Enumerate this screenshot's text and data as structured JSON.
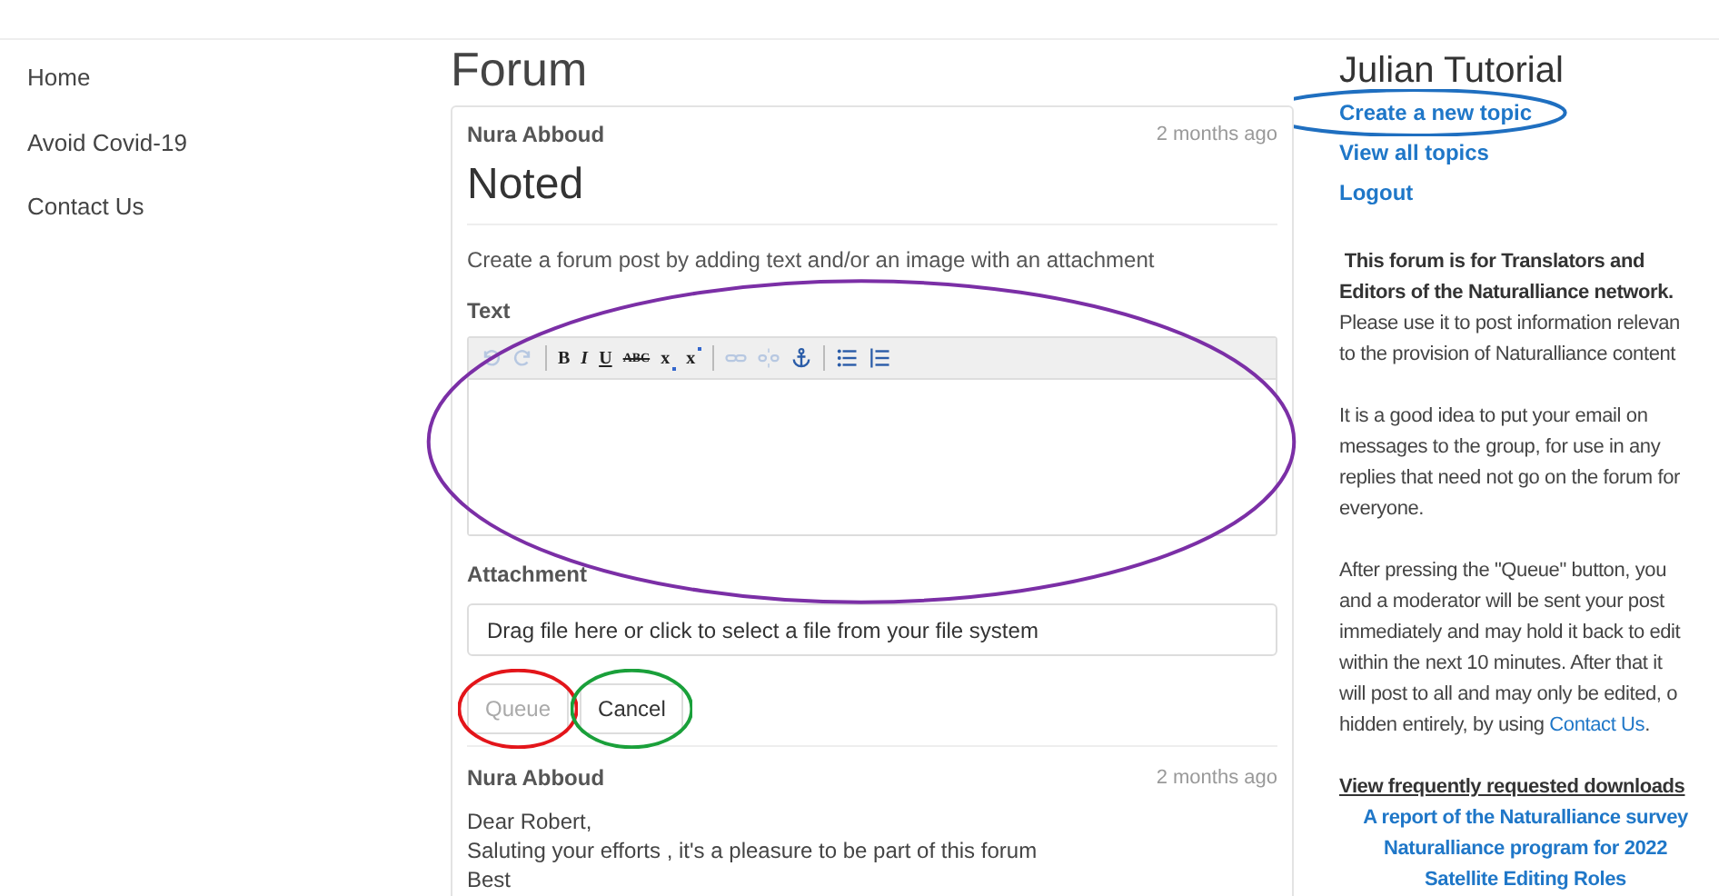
{
  "nav": [
    {
      "label": "Home"
    },
    {
      "label": "Avoid Covid-19"
    },
    {
      "label": "Contact Us"
    }
  ],
  "main": {
    "title": "Forum",
    "post": {
      "author": "Nura Abboud",
      "time": "2 months ago",
      "title": "Noted",
      "intro": "Create a forum post by adding text and/or an image with an attachment",
      "text_label": "Text",
      "editor": {
        "circled": true,
        "toolbar": [
          {
            "kind": "undo",
            "disabled": true
          },
          {
            "kind": "redo",
            "disabled": true
          },
          {
            "kind": "sep"
          },
          {
            "kind": "letter",
            "label": "B",
            "disabled": false
          },
          {
            "kind": "italic",
            "label": "I",
            "disabled": false
          },
          {
            "kind": "underline",
            "label": "U",
            "disabled": false
          },
          {
            "kind": "strike",
            "label": "ABC",
            "disabled": false
          },
          {
            "kind": "sub",
            "label": "x",
            "disabled": false
          },
          {
            "kind": "sup",
            "label": "x",
            "disabled": false
          },
          {
            "kind": "sep"
          },
          {
            "kind": "link",
            "disabled": true
          },
          {
            "kind": "unlink",
            "disabled": true
          },
          {
            "kind": "anchor",
            "disabled": false
          },
          {
            "kind": "sep"
          },
          {
            "kind": "bullets",
            "disabled": false
          },
          {
            "kind": "numbers",
            "disabled": false
          }
        ]
      },
      "attachment_label": "Attachment",
      "attachment_placeholder": "Drag file here or click to select a file from your file system",
      "buttons": [
        {
          "label": "Queue",
          "disabled": true,
          "circled": true
        },
        {
          "label": "Cancel",
          "disabled": false,
          "circled": true
        }
      ]
    },
    "reply": {
      "author": "Nura Abboud",
      "time": "2 months ago",
      "lines": [
        "Dear Robert,",
        "Saluting your efforts , it's a pleasure to be part of this forum",
        "Best"
      ]
    }
  },
  "sidebar": {
    "title": "Julian Tutorial",
    "links": [
      {
        "label": "Create a new topic",
        "circled": true
      },
      {
        "label": "View all topics",
        "circled": false
      },
      {
        "label": "Logout",
        "circled": false
      }
    ],
    "paragraphs": [
      [
        [
          {
            "kind": "bold",
            "text": " This forum is for Translators and"
          }
        ],
        [
          {
            "kind": "bold",
            "text": "Editors of the Naturalliance network."
          }
        ],
        [
          {
            "kind": "text",
            "text": "Please use it to post information relevan"
          }
        ],
        [
          {
            "kind": "text",
            "text": "to the provision of Naturalliance content"
          }
        ]
      ],
      [
        [
          {
            "kind": "text",
            "text": "It is a good idea to put your email on"
          }
        ],
        [
          {
            "kind": "text",
            "text": "messages to the group, for use in any"
          }
        ],
        [
          {
            "kind": "text",
            "text": "replies that need not go on the forum for"
          }
        ],
        [
          {
            "kind": "text",
            "text": "everyone."
          }
        ]
      ],
      [
        [
          {
            "kind": "text",
            "text": "After pressing the \"Queue\" button, you"
          }
        ],
        [
          {
            "kind": "text",
            "text": "and a moderator will be sent your post"
          }
        ],
        [
          {
            "kind": "text",
            "text": "immediately and may hold it back to edit"
          }
        ],
        [
          {
            "kind": "text",
            "text": "within the next 10 minutes. After that it"
          }
        ],
        [
          {
            "kind": "text",
            "text": "will post to all and may only be edited, o"
          }
        ],
        [
          {
            "kind": "text",
            "text": "hidden entirely, by using "
          },
          {
            "kind": "link",
            "text": "Contact Us"
          },
          {
            "kind": "text",
            "text": "."
          }
        ]
      ]
    ],
    "downloads_title": "View frequently requested downloads",
    "downloads": [
      "A report of the Naturalliance survey",
      "Naturalliance program for 2022",
      "Satellite Editing Roles"
    ]
  }
}
